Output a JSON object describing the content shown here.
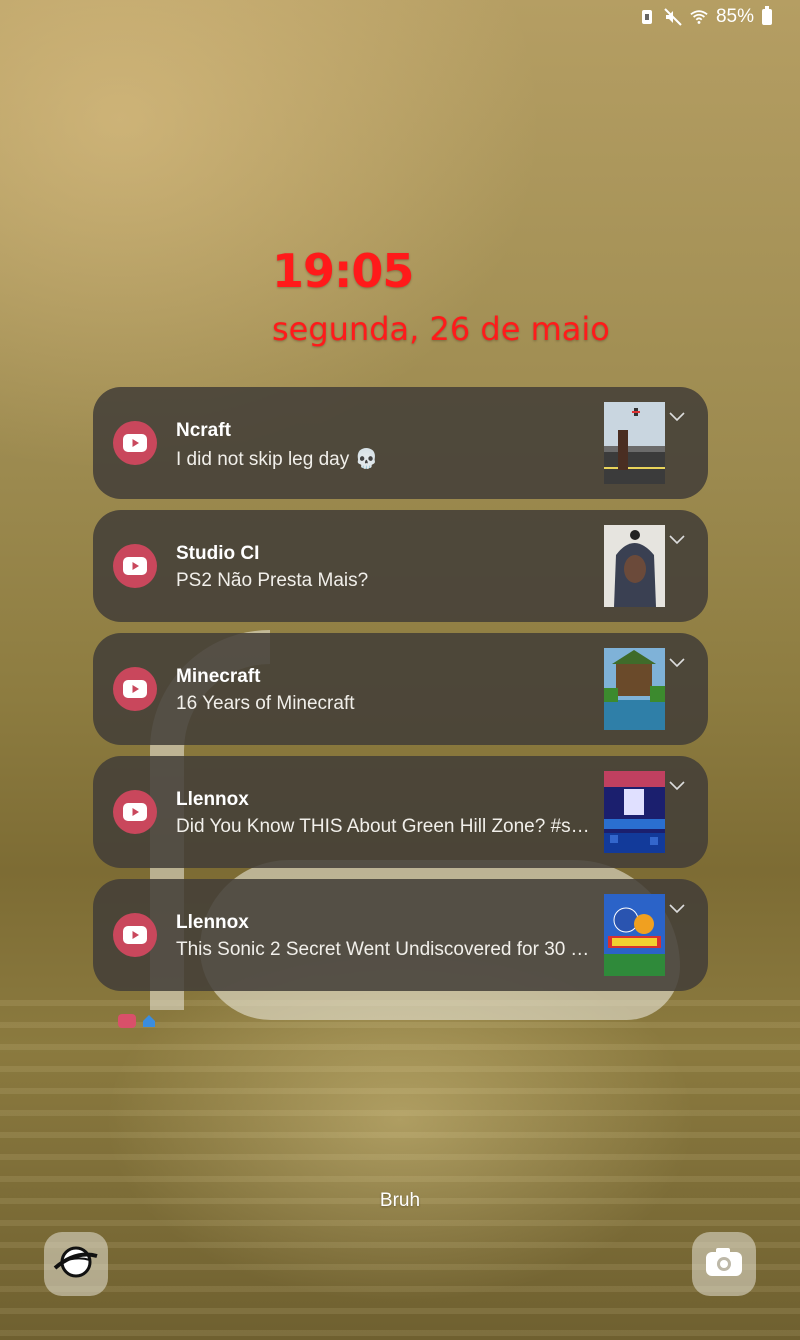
{
  "status_bar": {
    "battery_percent": "85%",
    "icons": [
      "data-saver-icon",
      "mute-icon",
      "wifi-icon",
      "battery-icon"
    ]
  },
  "lockscreen": {
    "time": "19:05",
    "date": "segunda, 26 de maio",
    "owner_info": "Bruh",
    "accent_color": "#ff1a1a"
  },
  "notifications": [
    {
      "app": "youtube",
      "title": "Ncraft",
      "text": "I did not skip leg day 💀",
      "thumb": "thumbnail-ncraft"
    },
    {
      "app": "youtube",
      "title": "Studio CI",
      "text": "PS2 Não Presta Mais?",
      "thumb": "thumbnail-studio-ci"
    },
    {
      "app": "youtube",
      "title": "Minecraft",
      "text": "16 Years of Minecraft",
      "thumb": "thumbnail-minecraft"
    },
    {
      "app": "youtube",
      "title": "Llennox",
      "text": "Did You Know THIS About Green Hill Zone? #so…",
      "thumb": "thumbnail-green-hill"
    },
    {
      "app": "youtube",
      "title": "Llennox",
      "text": "This Sonic 2 Secret Went Undiscovered for 30 Y…",
      "thumb": "thumbnail-sonic-2"
    }
  ],
  "shortcuts": {
    "left": "internet-browser-icon",
    "right": "camera-icon"
  },
  "colors": {
    "youtube_icon": "#c9475c",
    "card_background": "#423e38"
  }
}
